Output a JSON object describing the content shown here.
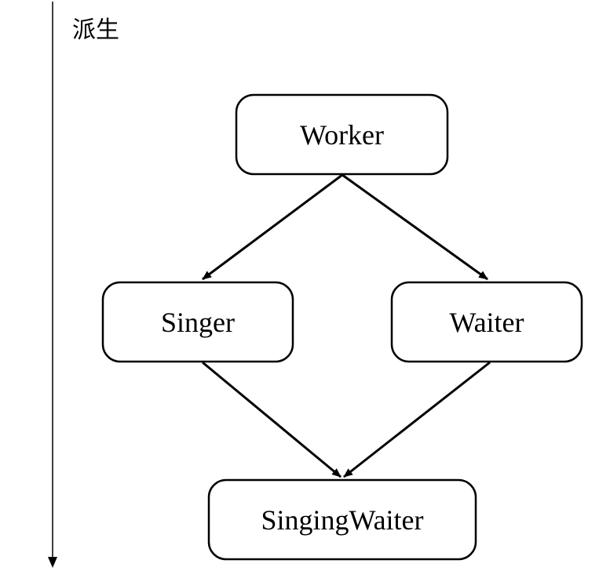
{
  "axis": {
    "label": "派生"
  },
  "nodes": {
    "worker": "Worker",
    "singer": "Singer",
    "waiter": "Waiter",
    "singing_waiter": "SingingWaiter"
  },
  "colors": {
    "stroke": "#000000",
    "fill": "#ffffff"
  }
}
